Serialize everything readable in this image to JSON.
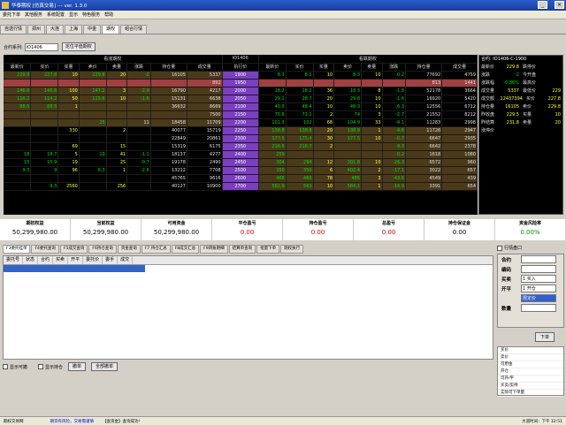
{
  "window": {
    "title": "华泰期权 [仿真交易] --- ver. 1.3.0"
  },
  "menu": [
    "委托下单",
    "其他服务",
    "系统配置",
    "显示",
    "特色服务",
    "帮助"
  ],
  "tabs": [
    "自选行情",
    "郑州",
    "大连",
    "上海",
    "中金",
    "期权",
    "组合行情"
  ],
  "toolbar": {
    "series_label": "合约系列:",
    "series_value": "IO1406",
    "locate_button": "定位平值期权"
  },
  "quote": {
    "call_title": "看涨期权",
    "put_title": "看跌期权",
    "strike_header": "IO1406",
    "call_headers": [
      "最新价",
      "买价",
      "买量",
      "卖价",
      "卖量",
      "涨跌",
      "持仓量",
      "成交量"
    ],
    "strike_col": "执行价",
    "put_headers": [
      "最新价",
      "买价",
      "买量",
      "卖价",
      "卖量",
      "涨跌",
      "持仓量",
      "成交量"
    ],
    "rows": [
      {
        "c": [
          "229.8",
          "227.8",
          "10",
          "229.8",
          "20",
          "-2",
          "16105",
          "5337"
        ],
        "k": "1900",
        "p": [
          "8.3",
          "8.1",
          "10",
          "8.3",
          "10",
          "-0.2",
          "77692",
          "4759"
        ]
      },
      {
        "c": [
          "",
          "",
          "",
          "",
          "",
          "",
          "",
          "892"
        ],
        "k": "1950",
        "p": [
          "",
          "",
          "",
          "",
          "",
          "",
          "813",
          "1441"
        ]
      },
      {
        "c": [
          "146.6",
          "146.6",
          "100",
          "147.2",
          "3",
          "-2.9",
          "16790",
          "4217"
        ],
        "k": "2000",
        "p": [
          "18.2",
          "18.2",
          "36",
          "18.3",
          "8",
          "-1.8",
          "52178",
          "3664"
        ]
      },
      {
        "c": [
          "116.2",
          "114.2",
          "50",
          "115.6",
          "10",
          "-1.6",
          "15131",
          "6638"
        ],
        "k": "2050",
        "p": [
          "29.1",
          "28.7",
          "20",
          "29.8",
          "10",
          "-1.6",
          "16920",
          "5420"
        ]
      },
      {
        "c": [
          "88.5",
          "88.5",
          "1",
          "",
          "",
          "",
          "36632",
          "8669"
        ],
        "k": "2100",
        "p": [
          "40.3",
          "48.4",
          "10",
          "48.3",
          "10",
          "-6.3",
          "12556",
          "6712"
        ]
      },
      {
        "c": [
          "",
          "",
          "",
          "",
          "",
          "",
          "",
          "7500"
        ],
        "k": "2150",
        "p": [
          "75.8",
          "73.1",
          "2",
          "74",
          "3",
          "-2.7",
          "21552",
          "8212"
        ]
      },
      {
        "c": [
          "",
          "",
          "",
          "25",
          "",
          "11",
          "18458",
          "11709"
        ],
        "k": "2200",
        "p": [
          "101.3",
          "102",
          "68",
          "104.9",
          "33",
          "-4.1",
          "11283",
          "2998"
        ]
      },
      {
        "c": [
          "",
          "",
          "330",
          "",
          "2",
          "",
          "40077",
          "15719"
        ],
        "k": "2250",
        "p": [
          "138.8",
          "138.8",
          "20",
          "138.9",
          "1",
          "-4.6",
          "11726",
          "2947"
        ]
      },
      {
        "c": [
          "",
          "",
          "",
          "",
          "",
          "",
          "22849",
          "20861"
        ],
        "k": "2300",
        "p": [
          "177.5",
          "175.4",
          "30",
          "177.5",
          "10",
          "-0.7",
          "6647",
          "2935"
        ]
      },
      {
        "c": [
          "",
          "",
          "69",
          "",
          "15",
          "",
          "15319",
          "6175"
        ],
        "k": "2350",
        "p": [
          "216.6",
          "216.7",
          "2",
          "",
          "",
          "-4.3",
          "6642",
          "2378"
        ]
      },
      {
        "c": [
          "18",
          "18.7",
          "5",
          "19",
          "41",
          "-1.1",
          "18137",
          "4277"
        ],
        "k": "2400",
        "p": [
          "259",
          "",
          "",
          "",
          "",
          "-0.2",
          "1618",
          "1080"
        ]
      },
      {
        "c": [
          "15",
          "15.9",
          "19",
          "",
          "25",
          "-0.7",
          "19178",
          "2490"
        ],
        "k": "2450",
        "p": [
          "304",
          "294",
          "12",
          "301.8",
          "10",
          "-26.3",
          "6572",
          "960"
        ]
      },
      {
        "c": [
          "9.3",
          "9",
          "96",
          "6.3",
          "1",
          "-2.6",
          "13212",
          "7708"
        ],
        "k": "2500",
        "p": [
          "350",
          "350",
          "6",
          "402.4",
          "2",
          "-17.1",
          "3022",
          "657"
        ]
      },
      {
        "c": [
          "",
          "",
          "",
          "",
          "",
          "",
          "45765",
          "9616"
        ],
        "k": "2600",
        "p": [
          "468",
          "460",
          "78",
          "486",
          "3",
          "-43.6",
          "4549",
          "439"
        ]
      },
      {
        "c": [
          "",
          "9.3",
          "2560",
          "",
          "256",
          "",
          "40127",
          "10900"
        ],
        "k": "2700",
        "p": [
          "582.9",
          "563",
          "10",
          "584.1",
          "1",
          "-16.9",
          "3391",
          "654"
        ]
      }
    ]
  },
  "side": {
    "contract": "IO1406-C-1900",
    "items": [
      [
        "合约:",
        "IO1406-C-1900"
      ],
      [
        "最新价",
        "229.8"
      ],
      [
        "涨跌",
        "-2"
      ],
      [
        "涨跌幅",
        "-0.86%"
      ],
      [
        "成交量",
        "5337"
      ],
      [
        "成交额",
        "12437394"
      ],
      [
        "持仓量",
        "16105"
      ],
      [
        "昨收盘",
        "229.5"
      ],
      [
        "昨结算",
        "231.8"
      ],
      [
        "涨停价",
        ""
      ],
      [
        "跌停价",
        ""
      ],
      [
        "今开盘",
        ""
      ],
      [
        "最高价",
        ""
      ],
      [
        "最低价",
        "229"
      ],
      [
        "买价",
        "227.8"
      ],
      [
        "卖价",
        "229.8"
      ],
      [
        "买量",
        "10"
      ],
      [
        "卖量",
        "20"
      ]
    ]
  },
  "account": [
    {
      "label": "期初权益",
      "value": "50,299,980.00"
    },
    {
      "label": "当前权益",
      "value": "50,299,980.00"
    },
    {
      "label": "可用资金",
      "value": "50,299,980.00"
    },
    {
      "label": "平仓盈亏",
      "value": "0.00"
    },
    {
      "label": "持仓盈亏",
      "value": "0.00"
    },
    {
      "label": "总盈亏",
      "value": "0.00"
    },
    {
      "label": "持仓保证金",
      "value": "0.00"
    },
    {
      "label": "资金风险率",
      "value": "0.00%"
    }
  ],
  "lowertabs": [
    "F3委托挂单",
    "F4委托查询",
    "F5成交查询",
    "F6持仓查询",
    "资金查询",
    "F7 持仓汇总",
    "F8成交汇总",
    "F9转账明细",
    "结算单查询",
    "批量下单",
    "期权执行"
  ],
  "grid": {
    "headers": [
      "委托号",
      "状态",
      "合约",
      "买卖",
      "开平",
      "委托价",
      "委手",
      "成交"
    ]
  },
  "bottom": {
    "show_cancelled": "显示可撤",
    "show_all": "显示持仓",
    "cancel": "撤单",
    "cancel_all": "全部撤单"
  },
  "order": {
    "quick": "行情盘口",
    "contract_label": "合约",
    "code_label": "编码",
    "side_label": "买卖",
    "side_value": "1 买入",
    "open_label": "开平",
    "open_value": "1 开仓",
    "price_label": "限定价",
    "qty_label": "数量",
    "submit": "下单",
    "info": [
      "买价",
      "卖价",
      "可用金",
      "开仓",
      "可开/平",
      "买卖/卖待",
      "实际可下单量"
    ]
  },
  "status": {
    "left": "期权交易网",
    "mid1": "期货有风险，交易需谨慎",
    "mid2": "【查资金】查询成功!",
    "right": "大道时间：下午 12:51"
  }
}
